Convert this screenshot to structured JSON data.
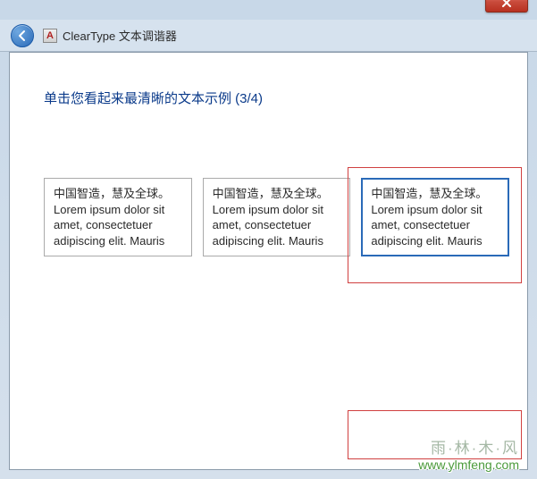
{
  "window": {
    "app_icon_letter": "A",
    "title": "ClearType 文本调谐器"
  },
  "instruction": "单击您看起来最清晰的文本示例 (3/4)",
  "samples": [
    {
      "text_cn": "中国智造，慧及全球。",
      "text_en": "Lorem ipsum dolor sit amet, consectetuer adipiscing elit. Mauris",
      "selected": false
    },
    {
      "text_cn": "中国智造，慧及全球。",
      "text_en": "Lorem ipsum dolor sit amet, consectetuer adipiscing elit. Mauris",
      "selected": false
    },
    {
      "text_cn": "中国智造，慧及全球。",
      "text_en": "Lorem ipsum dolor sit amet, consectetuer adipiscing elit. Mauris",
      "selected": true
    }
  ],
  "watermark": {
    "cn": "雨·林·木·风",
    "url": "www.ylmfeng.com"
  },
  "colors": {
    "heading": "#0a3a8a",
    "selected_border": "#2a6ab8",
    "highlight_border": "#d04040"
  }
}
